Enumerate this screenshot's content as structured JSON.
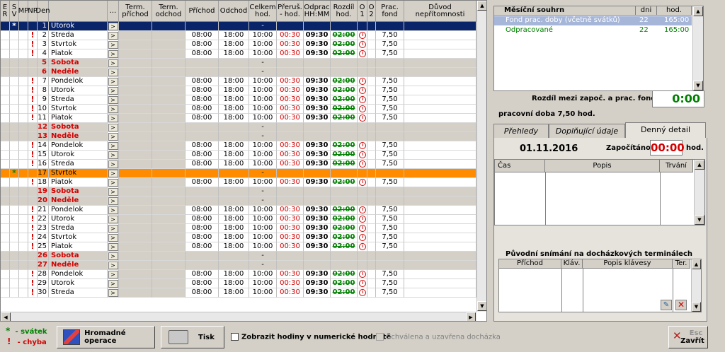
{
  "columns": [
    "E R",
    "S V",
    "MP",
    "NP",
    "Den",
    "",
    "...",
    "Term. příchod",
    "Term. odchod",
    "Příchod",
    "Odchod",
    "Celkem hod.",
    "Přeruš. - hod.",
    "Odprac HH:MM",
    "Rozdíl hod.",
    "O 1",
    "O 2",
    "Prac. fond",
    "Důvod nepřítomnosti"
  ],
  "rows": [
    {
      "den": "1",
      "day": "Utorok",
      "type": "sel",
      "sv": "*",
      "celk": "-"
    },
    {
      "den": "2",
      "day": "Streda",
      "np": "!",
      "prich": "08:00",
      "odch": "18:00",
      "celk": "10:00",
      "prer": "00:30",
      "odpr": "09:30",
      "rozd": "02:00",
      "fond": "7,50"
    },
    {
      "den": "3",
      "day": "Štvrtok",
      "np": "!",
      "prich": "08:00",
      "odch": "18:00",
      "celk": "10:00",
      "prer": "00:30",
      "odpr": "09:30",
      "rozd": "02:00",
      "fond": "7,50"
    },
    {
      "den": "4",
      "day": "Piatok",
      "np": "!",
      "prich": "08:00",
      "odch": "18:00",
      "celk": "10:00",
      "prer": "00:30",
      "odpr": "09:30",
      "rozd": "02:00",
      "fond": "7,50"
    },
    {
      "den": "5",
      "day": "Sobota",
      "type": "we",
      "celk": "-"
    },
    {
      "den": "6",
      "day": "Neděle",
      "type": "we",
      "celk": "-"
    },
    {
      "den": "7",
      "day": "Pondelok",
      "np": "!",
      "prich": "08:00",
      "odch": "18:00",
      "celk": "10:00",
      "prer": "00:30",
      "odpr": "09:30",
      "rozd": "02:00",
      "fond": "7,50"
    },
    {
      "den": "8",
      "day": "Utorok",
      "np": "!",
      "prich": "08:00",
      "odch": "18:00",
      "celk": "10:00",
      "prer": "00:30",
      "odpr": "09:30",
      "rozd": "02:00",
      "fond": "7,50"
    },
    {
      "den": "9",
      "day": "Streda",
      "np": "!",
      "prich": "08:00",
      "odch": "18:00",
      "celk": "10:00",
      "prer": "00:30",
      "odpr": "09:30",
      "rozd": "02:00",
      "fond": "7,50"
    },
    {
      "den": "10",
      "day": "Štvrtok",
      "np": "!",
      "prich": "08:00",
      "odch": "18:00",
      "celk": "10:00",
      "prer": "00:30",
      "odpr": "09:30",
      "rozd": "02:00",
      "fond": "7,50"
    },
    {
      "den": "11",
      "day": "Piatok",
      "np": "!",
      "prich": "08:00",
      "odch": "18:00",
      "celk": "10:00",
      "prer": "00:30",
      "odpr": "09:30",
      "rozd": "02:00",
      "fond": "7,50"
    },
    {
      "den": "12",
      "day": "Sobota",
      "type": "we",
      "celk": "-"
    },
    {
      "den": "13",
      "day": "Neděle",
      "type": "we",
      "celk": "-"
    },
    {
      "den": "14",
      "day": "Pondelok",
      "np": "!",
      "prich": "08:00",
      "odch": "18:00",
      "celk": "10:00",
      "prer": "00:30",
      "odpr": "09:30",
      "rozd": "02:00",
      "fond": "7,50"
    },
    {
      "den": "15",
      "day": "Utorok",
      "np": "!",
      "prich": "08:00",
      "odch": "18:00",
      "celk": "10:00",
      "prer": "00:30",
      "odpr": "09:30",
      "rozd": "02:00",
      "fond": "7,50"
    },
    {
      "den": "16",
      "day": "Streda",
      "np": "!",
      "prich": "08:00",
      "odch": "18:00",
      "celk": "10:00",
      "prer": "00:30",
      "odpr": "09:30",
      "rozd": "02:00",
      "fond": "7,50"
    },
    {
      "den": "17",
      "day": "Štvrtok",
      "type": "orange",
      "sv": "*",
      "celk": "-"
    },
    {
      "den": "18",
      "day": "Piatok",
      "np": "!",
      "prich": "08:00",
      "odch": "18:00",
      "celk": "10:00",
      "prer": "00:30",
      "odpr": "09:30",
      "rozd": "02:00",
      "fond": "7,50"
    },
    {
      "den": "19",
      "day": "Sobota",
      "type": "we",
      "celk": "-"
    },
    {
      "den": "20",
      "day": "Neděle",
      "type": "we",
      "celk": "-"
    },
    {
      "den": "21",
      "day": "Pondelok",
      "np": "!",
      "prich": "08:00",
      "odch": "18:00",
      "celk": "10:00",
      "prer": "00:30",
      "odpr": "09:30",
      "rozd": "02:00",
      "fond": "7,50"
    },
    {
      "den": "22",
      "day": "Utorok",
      "np": "!",
      "prich": "08:00",
      "odch": "18:00",
      "celk": "10:00",
      "prer": "00:30",
      "odpr": "09:30",
      "rozd": "02:00",
      "fond": "7,50"
    },
    {
      "den": "23",
      "day": "Streda",
      "np": "!",
      "prich": "08:00",
      "odch": "18:00",
      "celk": "10:00",
      "prer": "00:30",
      "odpr": "09:30",
      "rozd": "02:00",
      "fond": "7,50"
    },
    {
      "den": "24",
      "day": "Štvrtok",
      "np": "!",
      "prich": "08:00",
      "odch": "18:00",
      "celk": "10:00",
      "prer": "00:30",
      "odpr": "09:30",
      "rozd": "02:00",
      "fond": "7,50"
    },
    {
      "den": "25",
      "day": "Piatok",
      "np": "!",
      "prich": "08:00",
      "odch": "18:00",
      "celk": "10:00",
      "prer": "00:30",
      "odpr": "09:30",
      "rozd": "02:00",
      "fond": "7,50"
    },
    {
      "den": "26",
      "day": "Sobota",
      "type": "we",
      "celk": "-"
    },
    {
      "den": "27",
      "day": "Neděle",
      "type": "we",
      "celk": "-"
    },
    {
      "den": "28",
      "day": "Pondelok",
      "np": "!",
      "prich": "08:00",
      "odch": "18:00",
      "celk": "10:00",
      "prer": "00:30",
      "odpr": "09:30",
      "rozd": "02:00",
      "fond": "7,50"
    },
    {
      "den": "29",
      "day": "Utorok",
      "np": "!",
      "prich": "08:00",
      "odch": "18:00",
      "celk": "10:00",
      "prer": "00:30",
      "odpr": "09:30",
      "rozd": "02:00",
      "fond": "7,50"
    },
    {
      "den": "30",
      "day": "Streda",
      "np": "!",
      "prich": "08:00",
      "odch": "18:00",
      "celk": "10:00",
      "prer": "00:30",
      "odpr": "09:30",
      "rozd": "02:00",
      "fond": "7,50"
    }
  ],
  "summary": {
    "headers": [
      "Měsíční souhrn",
      "dni",
      "hod."
    ],
    "rows": [
      {
        "label": "Fond prac. doby (včetně svátků)",
        "dni": "22",
        "hod": "165:00",
        "selected": true
      },
      {
        "label": "Odpracované",
        "dni": "22",
        "hod": "165:00",
        "selected": false
      }
    ],
    "diff_label": "Rozdíl mezi započ. a prac. fondem",
    "diff_value": "0:00",
    "work_time": "pracovní doba 7,50 hod."
  },
  "tabs": [
    "Přehledy",
    "Doplňující údaje",
    "Denný detail"
  ],
  "detail": {
    "date": "01.11.2016",
    "counted_label": "Započítáno",
    "counted_value": "00:00",
    "counted_unit": "hod.",
    "headers": [
      "Čas",
      "Popis",
      "Trvání"
    ]
  },
  "terminals": {
    "title": "Původní snímání na docházkových terminálech",
    "headers": [
      "Příchod",
      "Kláv.",
      "Popis klávesy",
      "Ter."
    ]
  },
  "legend": {
    "holiday": "- svátek",
    "error": "- chyba"
  },
  "buttons": {
    "bulk": "Hromadné operace",
    "print": "Tisk",
    "numeric": "Zobrazit hodiny v numerické hodnotě",
    "approved": "Schválena a uzavřena docházka",
    "close_hint": "Esc",
    "close": "Zavřít"
  },
  "colors": {
    "selected": "#0a246a",
    "highlight": "#ff8c00",
    "weekend_text": "#d40000",
    "ok": "#008000"
  }
}
